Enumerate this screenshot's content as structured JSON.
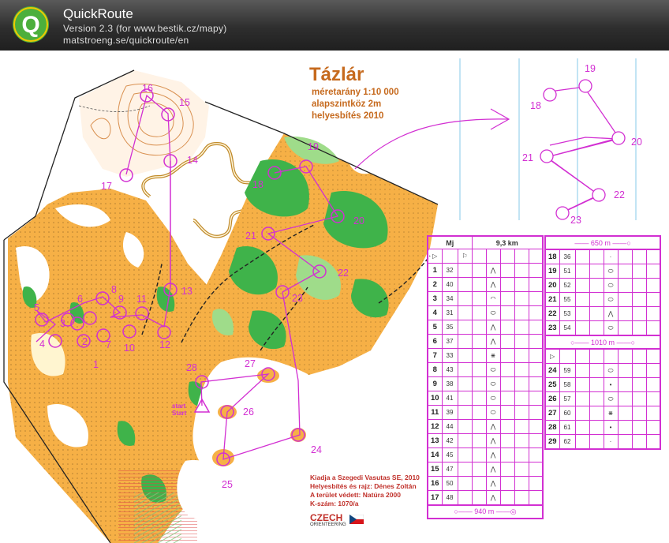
{
  "window": {
    "app_title": "QuickRoute",
    "version_line": "Version 2.3  (for www.bestik.cz/mapy)",
    "url_line": "matstroeng.se/quickroute/en",
    "logo_letter": "Q"
  },
  "map": {
    "title": "Tázlár",
    "scale": "méretarány 1:10 000",
    "contour": "alapszintköz 2m",
    "updated": "helyesbítés 2010",
    "start_label": "start Start",
    "credits": [
      "Kiadja a Szegedi Vasutas SE, 2010",
      "Helyesbítés és rajz: Dénes Zoltán",
      "A terület védett: Natúra 2000",
      "K-szám: 1070/a"
    ],
    "sponsor": {
      "word": "CZECH",
      "sub": "ORIENTEERING"
    },
    "controls_on_map": [
      "1",
      "2",
      "3",
      "4",
      "5",
      "6",
      "7",
      "8",
      "9",
      "10",
      "11",
      "12",
      "13",
      "14",
      "15",
      "16",
      "17",
      "18",
      "19",
      "20",
      "21",
      "22",
      "23",
      "24",
      "25",
      "26",
      "27",
      "28"
    ],
    "inset_controls": [
      "18",
      "19",
      "20",
      "21",
      "22",
      "23"
    ]
  },
  "descriptions": {
    "header_left": "Mj",
    "header_right": "9,3 km",
    "left_rows": [
      {
        "n": "1",
        "c": "32"
      },
      {
        "n": "2",
        "c": "40"
      },
      {
        "n": "3",
        "c": "34"
      },
      {
        "n": "4",
        "c": "31"
      },
      {
        "n": "5",
        "c": "35"
      },
      {
        "n": "6",
        "c": "37"
      },
      {
        "n": "7",
        "c": "33"
      },
      {
        "n": "8",
        "c": "43"
      },
      {
        "n": "9",
        "c": "38"
      },
      {
        "n": "10",
        "c": "41"
      },
      {
        "n": "11",
        "c": "39"
      },
      {
        "n": "12",
        "c": "44"
      },
      {
        "n": "13",
        "c": "42"
      },
      {
        "n": "14",
        "c": "45"
      },
      {
        "n": "15",
        "c": "47"
      },
      {
        "n": "16",
        "c": "50"
      },
      {
        "n": "17",
        "c": "48"
      }
    ],
    "leg_650": "650 m",
    "leg_1010": "1010 m",
    "leg_940": "940 m",
    "right_rows_a": [
      {
        "n": "18",
        "c": "36"
      },
      {
        "n": "19",
        "c": "51"
      },
      {
        "n": "20",
        "c": "52"
      },
      {
        "n": "21",
        "c": "55"
      },
      {
        "n": "22",
        "c": "53"
      },
      {
        "n": "23",
        "c": "54"
      }
    ],
    "right_rows_b": [
      {
        "n": "24",
        "c": "59"
      },
      {
        "n": "25",
        "c": "58"
      },
      {
        "n": "26",
        "c": "57"
      },
      {
        "n": "27",
        "c": "60"
      },
      {
        "n": "28",
        "c": "61"
      },
      {
        "n": "29",
        "c": "62"
      }
    ]
  },
  "colors": {
    "course": "#d22fd2",
    "map_orange": "#f5ab3a",
    "map_green": "#3fb34a",
    "titlebar": "#2e2e2e"
  }
}
